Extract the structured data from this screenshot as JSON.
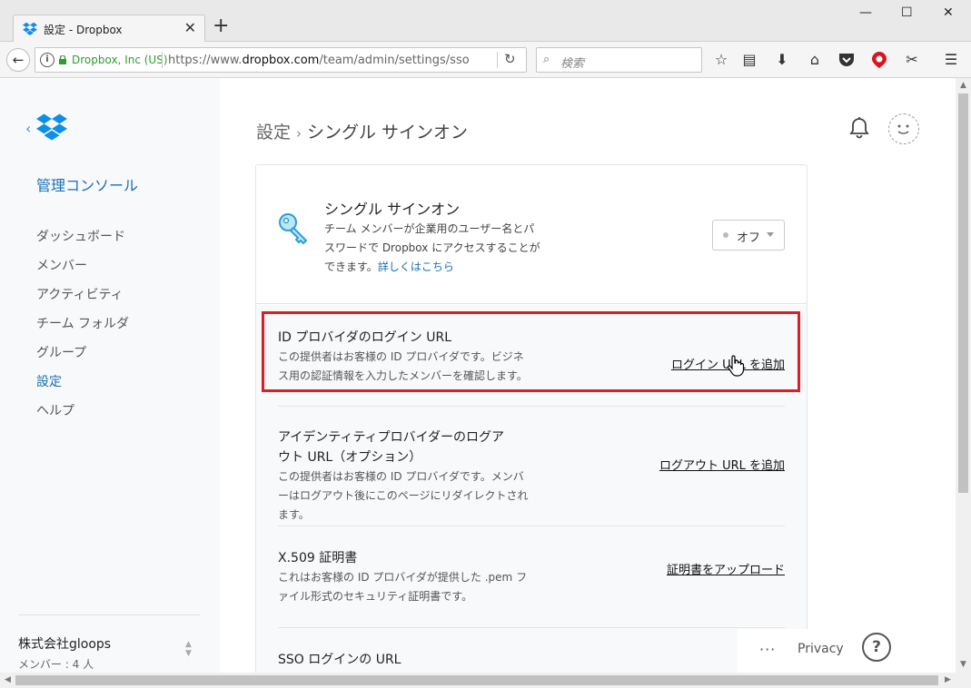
{
  "browser": {
    "tab_title": "設定 - Dropbox",
    "tab_close": "✕",
    "new_tab": "+",
    "win_min": "—",
    "win_max": "☐",
    "win_close": "✕",
    "back": "←",
    "site_identity": "Dropbox, Inc (US)",
    "url_prefix": "https://www.",
    "url_host": "dropbox.com",
    "url_path": "/team/admin/settings/sso",
    "search_placeholder": "検索",
    "toolbar_icons": [
      "star-icon",
      "reading-list-icon",
      "download-icon",
      "home-icon",
      "pocket-icon",
      "addon-red-icon",
      "addon-scissors-icon",
      "menu-icon"
    ]
  },
  "sidebar": {
    "console_title": "管理コンソール",
    "items": [
      {
        "label": "ダッシュボード",
        "active": false
      },
      {
        "label": "メンバー",
        "active": false
      },
      {
        "label": "アクティビティ",
        "active": false
      },
      {
        "label": "チーム フォルダ",
        "active": false
      },
      {
        "label": "グループ",
        "active": false
      },
      {
        "label": "設定",
        "active": true
      },
      {
        "label": "ヘルプ",
        "active": false
      }
    ],
    "company": "株式会社gloops",
    "members": "メンバー : 4 人"
  },
  "breadcrumb": {
    "parent": "設定",
    "separator": "›",
    "current": "シングル サインオン"
  },
  "sso": {
    "title": "シングル サインオン",
    "description": "チーム メンバーが企業用のユーザー名とパスワードで Dropbox にアクセスすることができます。",
    "learn_more": "詳しくはこちら",
    "toggle_label": "オフ"
  },
  "rows": [
    {
      "title": "ID プロバイダのログイン URL",
      "description": "この提供者はお客様の ID プロバイダです。ビジネス用の認証情報を入力したメンバーを確認します。",
      "action": "ログイン URL を追加"
    },
    {
      "title": "アイデンティティプロバイダーのログアウト URL（オプション）",
      "description": "この提供者はお客様の ID プロバイダです。メンバーはログアウト後にこのページにリダイレクトされます。",
      "action": "ログアウト URL を追加"
    },
    {
      "title": "X.509 証明書",
      "description": "これはお客様の ID プロバイダが提供した .pem ファイル形式のセキュリティ証明書です。",
      "action": "証明書をアップロード"
    },
    {
      "title": "SSO ログインの URL",
      "description": "",
      "action": ""
    }
  ],
  "footer": {
    "more": "···",
    "privacy": "Privacy",
    "help": "?"
  },
  "colors": {
    "accent": "#1a6fb5",
    "highlight": "#e01c24",
    "sidebar_bg": "#f7f9fa"
  }
}
